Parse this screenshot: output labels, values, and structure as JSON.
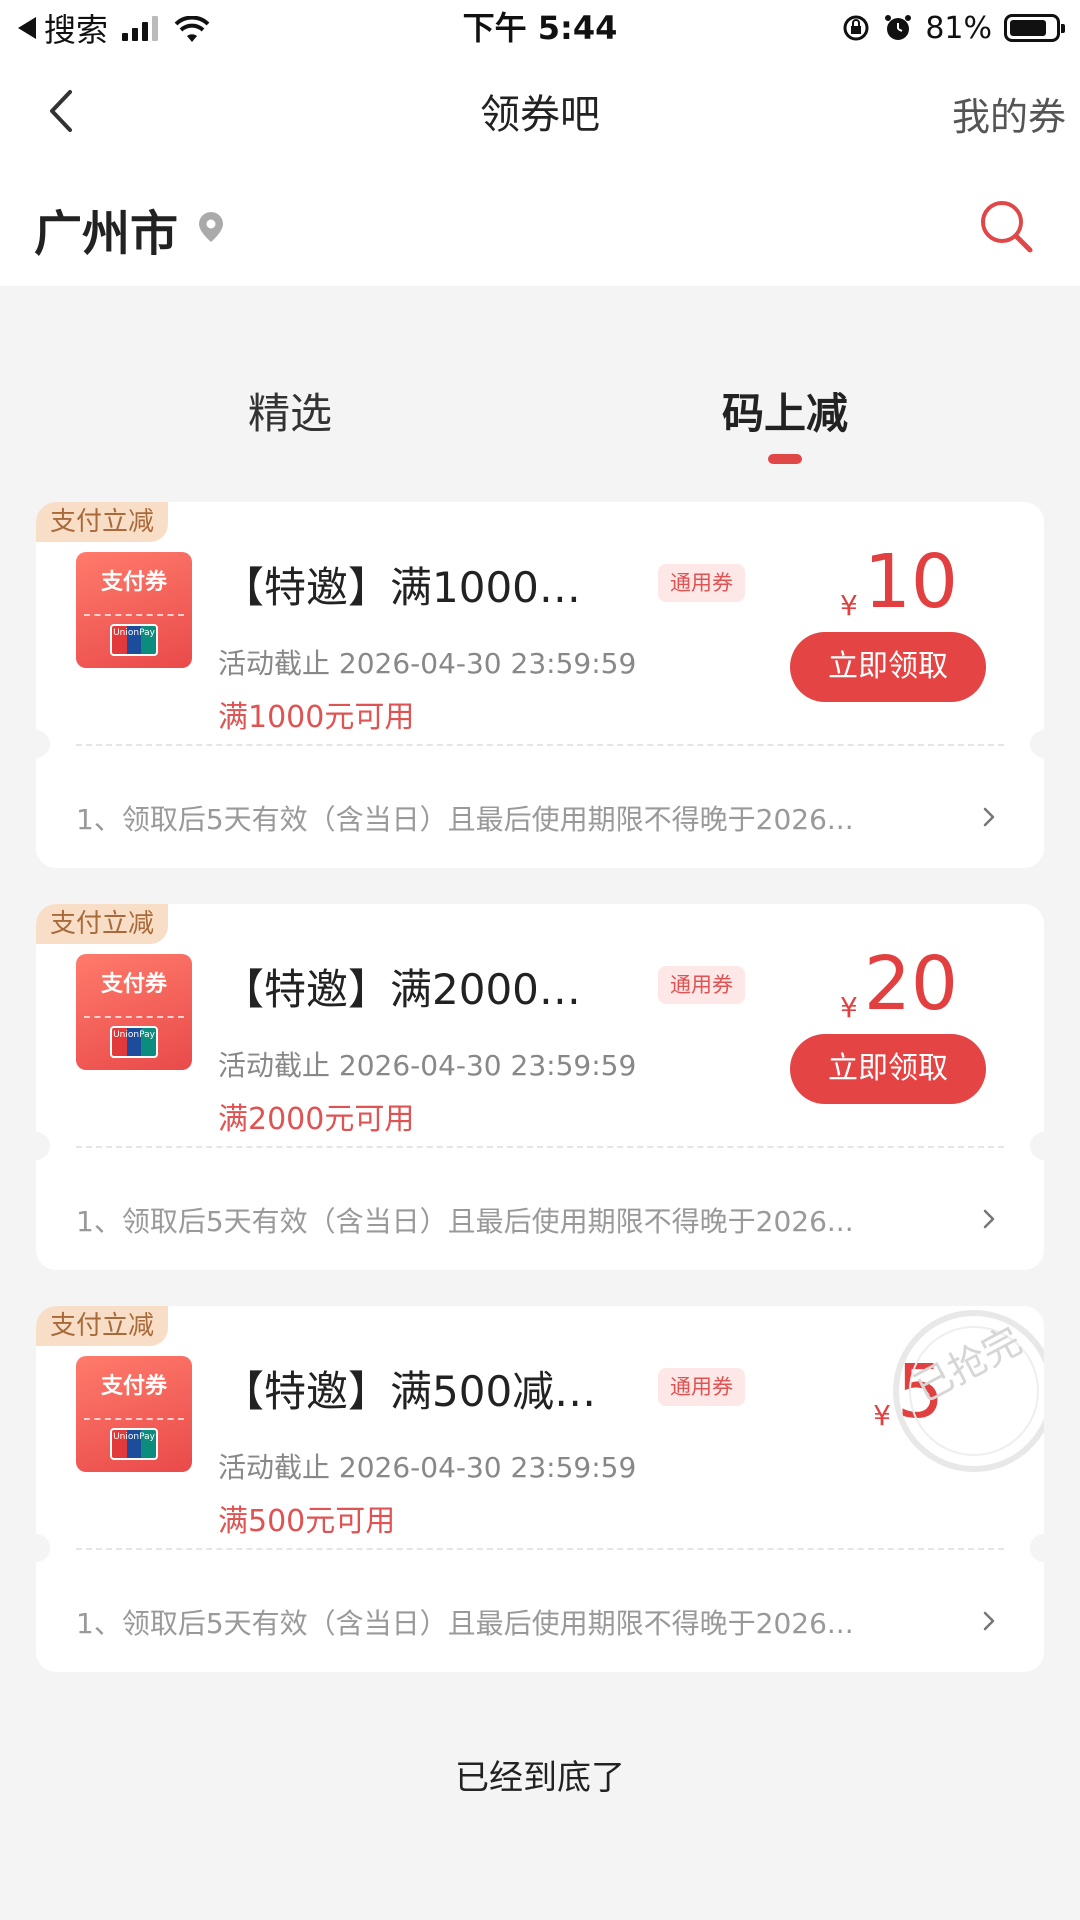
{
  "status_bar": {
    "back_app": "搜索",
    "time": "下午 5:44",
    "battery_pct": "81%",
    "battery_level": 0.81
  },
  "nav": {
    "title": "领券吧",
    "right_link": "我的券"
  },
  "location": {
    "city": "广州市"
  },
  "tabs": [
    {
      "label": "精选",
      "active": false
    },
    {
      "label": "码上减",
      "active": true
    }
  ],
  "accent_color": "#e44444",
  "coupons": [
    {
      "tag": "支付立减",
      "icon_label": "支付券",
      "title": "【特邀】满1000…",
      "badge": "通用券",
      "deadline": "活动截止 2026-04-30 23:59:59",
      "condition": "满1000元可用",
      "currency": "¥",
      "amount": "10",
      "action": "立即领取",
      "sold_out": false,
      "rule": "1、领取后5天有效（含当日）且最后使用期限不得晚于2026..."
    },
    {
      "tag": "支付立减",
      "icon_label": "支付券",
      "title": "【特邀】满2000…",
      "badge": "通用券",
      "deadline": "活动截止 2026-04-30 23:59:59",
      "condition": "满2000元可用",
      "currency": "¥",
      "amount": "20",
      "action": "立即领取",
      "sold_out": false,
      "rule": "1、领取后5天有效（含当日）且最后使用期限不得晚于2026..."
    },
    {
      "tag": "支付立减",
      "icon_label": "支付券",
      "title": "【特邀】满500减…",
      "badge": "通用券",
      "deadline": "活动截止 2026-04-30 23:59:59",
      "condition": "满500元可用",
      "currency": "¥",
      "amount": "5",
      "sold_out": true,
      "stamp_text": "已抢完",
      "rule": "1、领取后5天有效（含当日）且最后使用期限不得晚于2026..."
    }
  ],
  "footer": {
    "end_text": "已经到底了"
  }
}
